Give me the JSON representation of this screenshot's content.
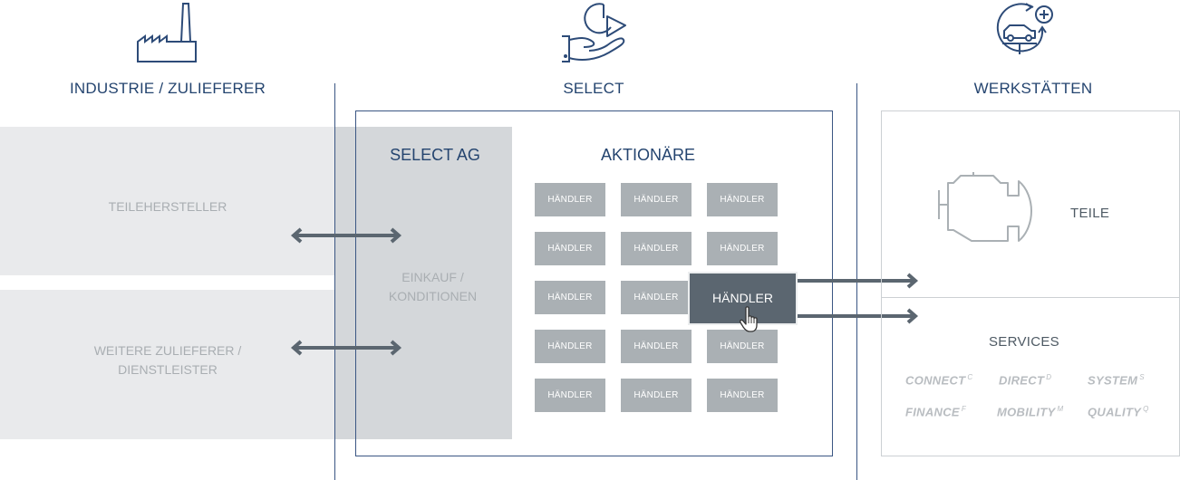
{
  "columns": {
    "industrie": {
      "title": "INDUSTRIE / ZULIEFERER",
      "icon": "factory-icon"
    },
    "select": {
      "title": "SELECT",
      "icon": "hand-holding-pie-chart-icon"
    },
    "werkstaetten": {
      "title": "WERKSTÄTTEN",
      "icon": "car-lift-service-icon"
    }
  },
  "suppliers": [
    {
      "label": "TEILEHERSTELLER"
    },
    {
      "label": "WEITERE ZULIEFERER / DIENSTLEISTER"
    }
  ],
  "select_ag": {
    "title": "SELECT AG",
    "label": "EINKAUF / KONDITIONEN"
  },
  "aktionaere": {
    "title": "AKTIONÄRE",
    "tiles": [
      [
        "HÄNDLER",
        "HÄNDLER",
        "HÄNDLER"
      ],
      [
        "HÄNDLER",
        "HÄNDLER",
        "HÄNDLER"
      ],
      [
        "HÄNDLER",
        "HÄNDLER",
        "HÄNDLER"
      ],
      [
        "HÄNDLER",
        "HÄNDLER",
        "HÄNDLER"
      ],
      [
        "HÄNDLER",
        "HÄNDLER",
        "HÄNDLER"
      ]
    ],
    "highlighted": {
      "label": "HÄNDLER",
      "row": 3,
      "col": 3
    }
  },
  "werkstatt": {
    "teile": {
      "label": "TEILE",
      "icon": "engine-icon"
    },
    "services": {
      "title": "SERVICES",
      "items": [
        {
          "name": "CONNECT",
          "mark": "C"
        },
        {
          "name": "DIRECT",
          "mark": "D"
        },
        {
          "name": "SYSTEM",
          "mark": "S"
        },
        {
          "name": "FINANCE",
          "mark": "F"
        },
        {
          "name": "MOBILITY",
          "mark": "M"
        },
        {
          "name": "QUALITY",
          "mark": "Q"
        }
      ]
    }
  },
  "colors": {
    "brand_blue": "#24446f",
    "arrow_grey": "#5b6670",
    "tile_grey": "#aab0b4",
    "band_light": "#e9eaec",
    "band_dark": "#d4d7da"
  }
}
